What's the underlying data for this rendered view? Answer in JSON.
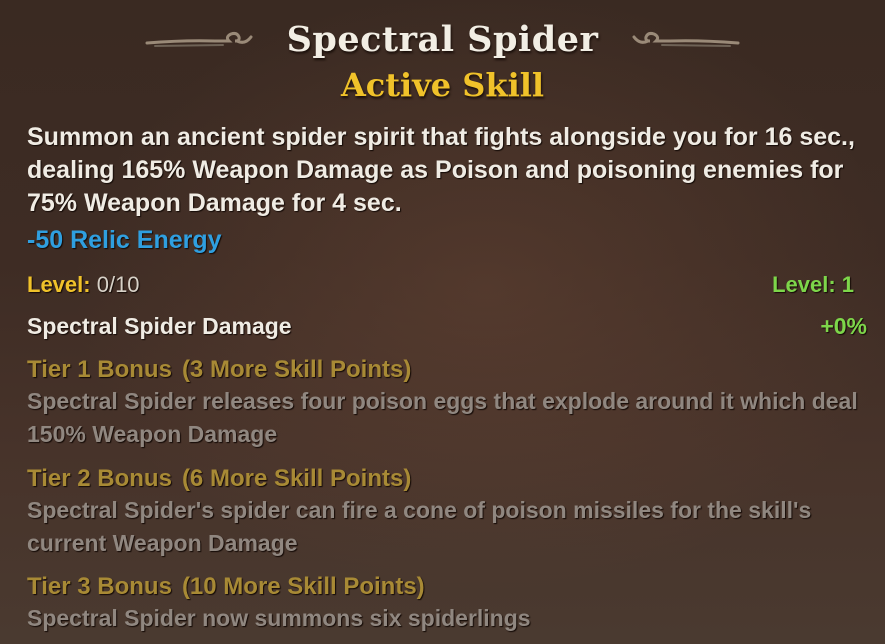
{
  "tooltip": {
    "title": "Spectral Spider",
    "subtitle": "Active Skill",
    "description": "Summon an ancient spider spirit that fights alongside you for 16 sec., dealing 165% Weapon Damage as Poison and poisoning enemies for 75% Weapon Damage for 4 sec.",
    "energy_cost": "-50 Relic Energy",
    "level_label": "Level:",
    "level_value": "0/10",
    "next_level": "Level: 1",
    "stat_name": "Spectral Spider Damage",
    "stat_value": "+0%",
    "tiers": [
      {
        "name": "Tier 1 Bonus",
        "points": "(3 More Skill Points)",
        "text": "Spectral Spider releases four poison eggs that explode around it which deal 150% Weapon Damage"
      },
      {
        "name": "Tier 2 Bonus",
        "points": "(6 More Skill Points)",
        "text": "Spectral Spider's spider can fire a cone of poison missiles for the skill's current Weapon Damage"
      },
      {
        "name": "Tier 3 Bonus",
        "points": "(10 More Skill Points)",
        "text": "Spectral Spider now summons six spiderlings"
      }
    ]
  },
  "colors": {
    "title": "#f2eee4",
    "subtitle": "#f0c22a",
    "energy": "#2f9fe0",
    "positive": "#7dd64a",
    "tier_head": "#a88a35",
    "tier_text": "#908780"
  },
  "icons": {
    "left_flourish": "ornament-left-icon",
    "right_flourish": "ornament-right-icon"
  }
}
